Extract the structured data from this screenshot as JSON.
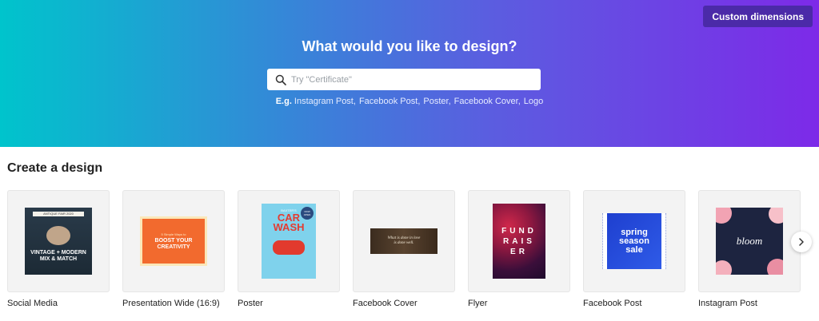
{
  "header": {
    "custom_dimensions_label": "Custom dimensions",
    "title": "What would you like to design?",
    "search": {
      "placeholder": "Try \"Certificate\"",
      "icon": "search-icon"
    },
    "examples": {
      "prefix": "E.g.",
      "items": [
        "Instagram Post",
        "Facebook Post",
        "Poster",
        "Facebook Cover",
        "Logo"
      ]
    },
    "gradient": [
      "#00c4cc",
      "#7d2ae8"
    ]
  },
  "section": {
    "title": "Create a design"
  },
  "designs": [
    {
      "label": "Social Media",
      "thumb_lines": [
        "VINTAGE + MODERN",
        "MIX & MATCH"
      ],
      "thumb_top": "ANTIQUE FAIR 2020"
    },
    {
      "label": "Presentation Wide (16:9)",
      "thumb_lines": [
        "BOOST YOUR",
        "CREATIVITY"
      ],
      "thumb_top": "5 Simple Ways to"
    },
    {
      "label": "Poster",
      "thumb_lines": [
        "CAR",
        "WASH"
      ],
      "thumb_top": "BAXTER'S",
      "badge": "NOW OPEN"
    },
    {
      "label": "Facebook Cover",
      "thumb_lines": [
        "What is done in love",
        "is done well."
      ]
    },
    {
      "label": "Flyer",
      "thumb_lines": [
        "FUND",
        "RAIS",
        "ER"
      ]
    },
    {
      "label": "Facebook Post",
      "thumb_lines": [
        "spring",
        "season",
        "sale"
      ]
    },
    {
      "label": "Instagram Post",
      "thumb_lines": [
        "bloom"
      ]
    }
  ],
  "carousel": {
    "next_icon": "chevron-right-icon"
  }
}
